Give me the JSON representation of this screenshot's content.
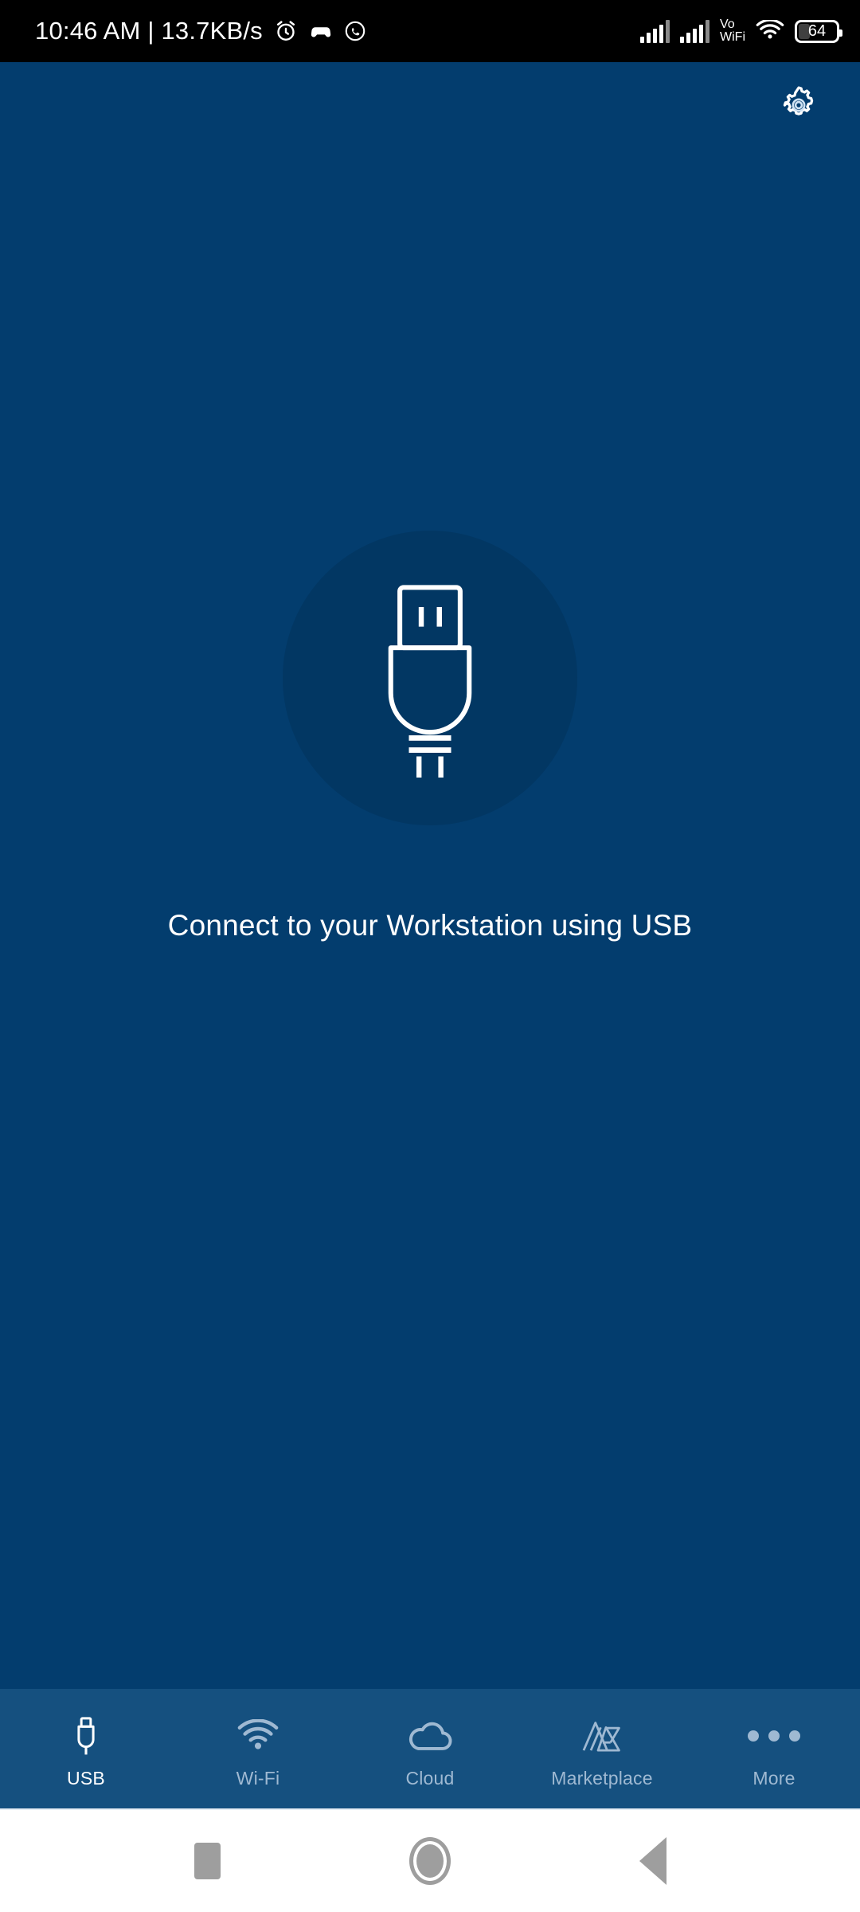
{
  "status_bar": {
    "clock": "10:46 AM | 13.7KB/s",
    "left_icons": [
      "alarm-icon",
      "game-controller-icon",
      "whatsapp-icon"
    ],
    "network_label": "Vo",
    "network_label2": "WiFi",
    "battery_level": "64",
    "right_icons": [
      "signal-bars-sim1",
      "signal-bars-sim2",
      "vowifi-indicator",
      "wifi-icon",
      "battery-icon"
    ]
  },
  "app": {
    "settings_icon": "gear-icon",
    "hero": {
      "icon": "usb-connector-icon",
      "caption": "Connect to your Workstation using USB",
      "circle_color": "#023763"
    },
    "background_color": "#033d6e",
    "nav": {
      "background_color": "#15507f",
      "active_color": "#ffffff",
      "inactive_color": "#9fb9d2",
      "items": [
        {
          "label": "USB",
          "icon": "usb-plug-icon",
          "active": true
        },
        {
          "label": "Wi-Fi",
          "icon": "wifi-icon",
          "active": false
        },
        {
          "label": "Cloud",
          "icon": "cloud-icon",
          "active": false
        },
        {
          "label": "Marketplace",
          "icon": "marketplace-logo-icon",
          "active": false
        },
        {
          "label": "More",
          "icon": "more-dots-icon",
          "active": false
        }
      ]
    }
  },
  "system_nav": {
    "recents_label": "Recents",
    "home_label": "Home",
    "back_label": "Back"
  }
}
